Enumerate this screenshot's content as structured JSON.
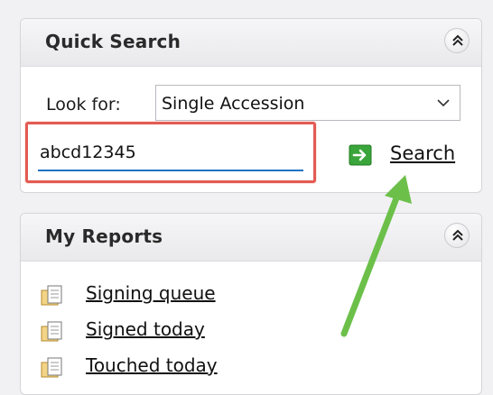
{
  "quick_search": {
    "title": "Quick Search",
    "look_for_label": "Look for:",
    "look_for_value": "Single Accession",
    "search_value": "abcd12345",
    "search_button_label": "Search"
  },
  "my_reports": {
    "title": "My Reports",
    "items": [
      {
        "label": "Signing queue"
      },
      {
        "label": "Signed today"
      },
      {
        "label": "Touched today"
      }
    ]
  },
  "annotation": {
    "highlight_color": "#e35b53",
    "arrow_color": "#6cc04a"
  },
  "icons": {
    "collapse": "double-chevron-up-icon",
    "dropdown": "chevron-down-icon",
    "go": "green-arrow-right-icon",
    "report": "document-folder-icon"
  }
}
